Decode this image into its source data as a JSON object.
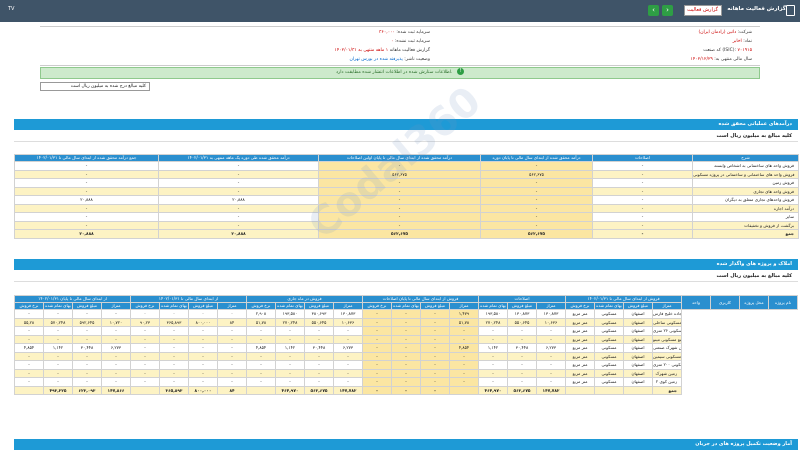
{
  "topbar": {
    "title": "گزارش فعالیت ماهانه",
    "select_value": "گزارش فعالیت",
    "left_label": "TV",
    "prev_icon": "chevron-left-icon",
    "next_icon": "chevron-right-icon"
  },
  "info": {
    "company_label": "شرکت:",
    "company_value": "داتین (رادمان ایران)",
    "symbol_label": "نماد:",
    "symbol_value": "اخابر",
    "capital_label": "سرمایه ثبت شده:",
    "capital_value": "۳۶۰,۰۰۰",
    "unregistered_label": "سرمایه ثبت نشده:",
    "unregistered_value": "۰",
    "isic_label": "کد صنعت (ISIC):",
    "isic_value": "۷۰۱۹۱۵",
    "report_label": "گزارش فعالیت ماهانه",
    "report_value": "۱ ماهه منتهی به ۱۴۰۲/۰۱/۳۱",
    "fiscal_label": "سال مالی منتهی به:",
    "fiscal_value": "۱۴۰۲/۱۲/۲۹",
    "status_label": "وضعیت ناشر:",
    "status_value": "پذیرفته شده در بورس تهران"
  },
  "notice": {
    "text": "اطلاعات ستارش شده در اطلاعات انتشار شده مطابقت دارد.",
    "icon": "check-circle-icon"
  },
  "units": {
    "text": "کلیه مبالغ درج شده به میلیون ریال است"
  },
  "section1": {
    "title": "درآمدهای عملیاتی محقق شده",
    "subtitle": "کلیه مبالغ به میلیون ریال است",
    "headers": [
      "شرح",
      "اصلاحات",
      "درآمد محقق شده از ابتدای سال مالی تا پایان دوره",
      "درآمد محقق شده از ابتدای سال مالی تا پایان اولین اصلاحات",
      "درآمد محقق شده طی دوره یک ماهه منتهی به ۱۴۰۲/۰۱/۳۱",
      "جمع درآمد محقق شده از ابتدای سال مالی تا ۱۴۰۲/۰۱/۳۱"
    ],
    "rows": [
      [
        "فروش واحد های ساختمانی به اشخاص وابسته",
        "-",
        "-",
        "-",
        "-",
        "-"
      ],
      [
        "فروش واحد های ساختمانی و ساختمانی در پروژه مسکونی",
        "-",
        "۵۶۲,۶۷۵",
        "۵۶۲,۶۷۵",
        "-",
        "-"
      ],
      [
        "فروش زمین",
        "-",
        "-",
        "-",
        "-",
        "-"
      ],
      [
        "فروش واحد های تجاری",
        "-",
        "-",
        "-",
        "-",
        "-"
      ],
      [
        "فروش واحدهای تجاری متعلق به دیگران",
        "-",
        "-",
        "-",
        "۲۰,۸۸۸",
        "۲۰,۸۸۸"
      ],
      [
        "درآمد اجاره",
        "-",
        "-",
        "-",
        "-",
        "-"
      ],
      [
        "سایر",
        "-",
        "-",
        "-",
        "-",
        "-"
      ],
      [
        "برگشت از فروش و تخفیفات",
        "-",
        "-",
        "-",
        "-",
        "-"
      ],
      [
        "جمع",
        "-",
        "۵۶۲,۶۷۵",
        "۵۶۲,۶۷۵",
        "۲۰,۸۸۸",
        "۲۰,۸۸۸"
      ]
    ]
  },
  "section2": {
    "title": "املاک و پروژه های واگذار شده",
    "subtitle": "کلیه مبالغ به میلیون ریال است",
    "group_headers": [
      "نام پروژه",
      "محل پروژه",
      "کاربری",
      "واحد",
      "فروش از ابتدای سال مالی تا ۱۴۰۲/۰۱/۳۱",
      "اصلاحات",
      "فروش از ابتدای سال مالی تا پایان اصلاحات",
      "فروش در ماه جاری",
      "از ابتدای سال مالی تا ۱۴۰۲/۰۱/۳۱",
      "از ابتدای سال مالی تا پایان ۱۴۰۲/۰۱/۳۱"
    ],
    "sub_headers": [
      "متراژ",
      "مبلغ فروش",
      "بهای تمام شده",
      "نرخ فروش"
    ],
    "rows": [
      [
        "زمین ۲ کیلومتر جاده خلیج فارس",
        "اصفهان",
        "مسکونی",
        "متر مربع",
        "۱۳۰,۸۷۳",
        "۱۳۰,۸۷۳",
        "۱۹۳,۵۸۰",
        "۱,۴۷۹",
        "-",
        "-",
        "-",
        "۱۳۰,۸۷۳",
        "۳۸۰,۶۹۳",
        "۱۹۳,۵۸۰",
        "۲,۹۰۸",
        "۰",
        "۰",
        "۰",
        "۰",
        "-",
        "-",
        "-",
        "-"
      ],
      [
        "مجتمع مسکونی ساحلی",
        "اصفهان",
        "مسکونی",
        "متر مربع",
        "۱۰,۶۳۶",
        "۵۵۰,۶۴۵",
        "۲۷۰,۲۴۸",
        "۵۱,۷۸",
        "-",
        "-",
        "-",
        "۱۰,۶۳۶",
        "۵۵۰,۶۴۵",
        "۲۷۰,۲۴۸",
        "۵۱,۷۸",
        "۸۴",
        "۸۰۰,۰۰۰",
        "۳۶۵,۸۹۳",
        "۹۰,۲۳",
        "۱۰,۷۲۰",
        "۵۹۲,۶۴۵",
        "۵۷۰,۲۴۸",
        "۵۵,۲۸"
      ],
      [
        "مجتمع مسکونی ۲۶ متری",
        "اصفهان",
        "مسکونی",
        "متر مربع",
        "-",
        "-",
        "-",
        "-",
        "-",
        "-",
        "-",
        "-",
        "-",
        "-",
        "-",
        "-",
        "-",
        "-",
        "-",
        "-",
        "-",
        "-",
        "-"
      ],
      [
        "مجتمع مسکونی مینو",
        "اصفهان",
        "مسکونی",
        "متر مربع",
        "-",
        "-",
        "-",
        "-",
        "-",
        "-",
        "-",
        "-",
        "-",
        "-",
        "-",
        "-",
        "-",
        "-",
        "-",
        "-",
        "-",
        "-",
        "-"
      ],
      [
        "زمین شهرک صنعتی",
        "اصفهان",
        "مسکونی",
        "متر مربع",
        "۶,۲۷۳",
        "۳۰,۴۴۸",
        "۱,۱۴۲",
        "۴,۸۵۴",
        "-",
        "-",
        "-",
        "۶,۲۷۳",
        "۳۰,۴۴۸",
        "۱,۱۴۲",
        "۴,۸۵۴",
        "-",
        "-",
        "-",
        "-",
        "۶,۲۷۳",
        "۳۰,۴۴۸",
        "۱,۱۴۲",
        "۴,۸۵۴"
      ],
      [
        "مجتمع مسکونی سیمین",
        "اصفهان",
        "مسکونی",
        "متر مربع",
        "-",
        "-",
        "-",
        "-",
        "-",
        "-",
        "-",
        "-",
        "-",
        "-",
        "-",
        "-",
        "-",
        "-",
        "-",
        "-",
        "-",
        "-",
        "-"
      ],
      [
        "پروژه مسکونی ۲۰۰ متری",
        "اصفهان",
        "مسکونی",
        "متر مربع",
        "-",
        "-",
        "-",
        "-",
        "-",
        "-",
        "-",
        "-",
        "-",
        "-",
        "-",
        "-",
        "-",
        "-",
        "-",
        "-",
        "-",
        "-",
        "-"
      ],
      [
        "زمین شهرک",
        "اصفهان",
        "مسکونی",
        "متر مربع",
        "-",
        "-",
        "-",
        "-",
        "-",
        "-",
        "-",
        "-",
        "-",
        "-",
        "-",
        "-",
        "-",
        "-",
        "-",
        "-",
        "-",
        "-",
        "-"
      ],
      [
        "زمین کوی ۲",
        "اصفهان",
        "مسکونی",
        "متر مربع",
        "-",
        "-",
        "-",
        "-",
        "-",
        "-",
        "-",
        "-",
        "-",
        "-",
        "-",
        "-",
        "-",
        "-",
        "-",
        "-",
        "-",
        "-",
        "-"
      ],
      [
        "جمع",
        "",
        "",
        "",
        "۱۴۷,۷۸۲",
        "۵۶۲,۶۷۵",
        "۴۶۴,۹۷۰",
        "",
        "-",
        "-",
        "-",
        "۱۴۷,۷۸۲",
        "۵۶۲,۶۷۵",
        "۴۶۴,۹۷۰",
        "",
        "۸۴",
        "۸۰۰,۰۰۰",
        "۳۶۵,۸۹۳",
        "",
        "۱۴۷,۸۶۶",
        "۶۲۳,۰۹۳",
        "۴۹۳,۳۲۵",
        ""
      ]
    ]
  },
  "section3": {
    "title": "آمار وضعیت تکمیل پروژه های در جریان"
  }
}
